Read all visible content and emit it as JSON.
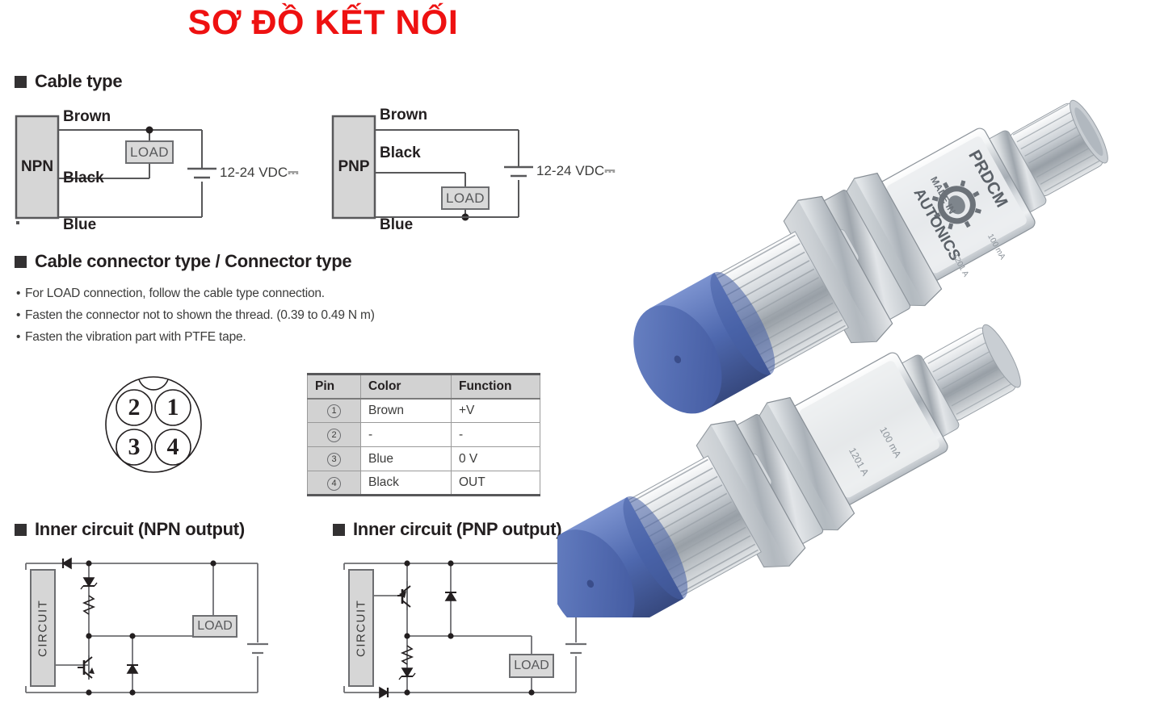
{
  "title": "SƠ ĐỒ KẾT NỐI",
  "title_color": "#ee1111",
  "sections": {
    "cable_type": {
      "heading": "Cable type"
    },
    "connector_type": {
      "heading": "Cable connector type / Connector type"
    },
    "inner_npn": {
      "heading": "Inner circuit (NPN output)"
    },
    "inner_pnp": {
      "heading": "Inner circuit (PNP output)"
    }
  },
  "cable_type": {
    "npn": {
      "box_label": "NPN",
      "wires": [
        "Brown",
        "Black",
        "Blue"
      ],
      "load_label": "LOAD",
      "supply_label": "12-24 VDC",
      "dc_symbol": "⎓"
    },
    "pnp": {
      "box_label": "PNP",
      "wires": [
        "Brown",
        "Black",
        "Blue"
      ],
      "load_label": "LOAD",
      "supply_label": "12-24 VDC",
      "dc_symbol": "⎓"
    }
  },
  "notes": [
    "For LOAD connection, follow the cable type connection.",
    "Fasten the connector not to shown the thread. (0.39 to 0.49 N m)",
    "Fasten the vibration part with PTFE tape."
  ],
  "connector_pinout": {
    "pins": [
      "2",
      "1",
      "3",
      "4"
    ]
  },
  "pin_table": {
    "headers": [
      "Pin",
      "Color",
      "Function"
    ],
    "rows": [
      {
        "pin": "①",
        "pin_num": "1",
        "color": "Brown",
        "function": "+V"
      },
      {
        "pin": "②",
        "pin_num": "2",
        "color": "-",
        "function": "-"
      },
      {
        "pin": "③",
        "pin_num": "3",
        "color": "Blue",
        "function": "0 V"
      },
      {
        "pin": "④",
        "pin_num": "4",
        "color": "Black",
        "function": "OUT"
      }
    ]
  },
  "inner_circuits": {
    "npn": {
      "block_label": "CIRCUIT",
      "load_label": "LOAD"
    },
    "pnp": {
      "block_label": "CIRCUIT",
      "load_label": "LOAD"
    }
  },
  "product_photo": {
    "alt": "Two cylindrical inductive proximity sensors with blue sensing faces, chrome-plated threaded barrels, hex nuts and M12 connector",
    "brand_text": "AUTONICS",
    "origin_text": "MADE IN",
    "model_text": "PRDCM",
    "face_color": "#4f6cb5",
    "body_color": "#c9cdd2"
  }
}
